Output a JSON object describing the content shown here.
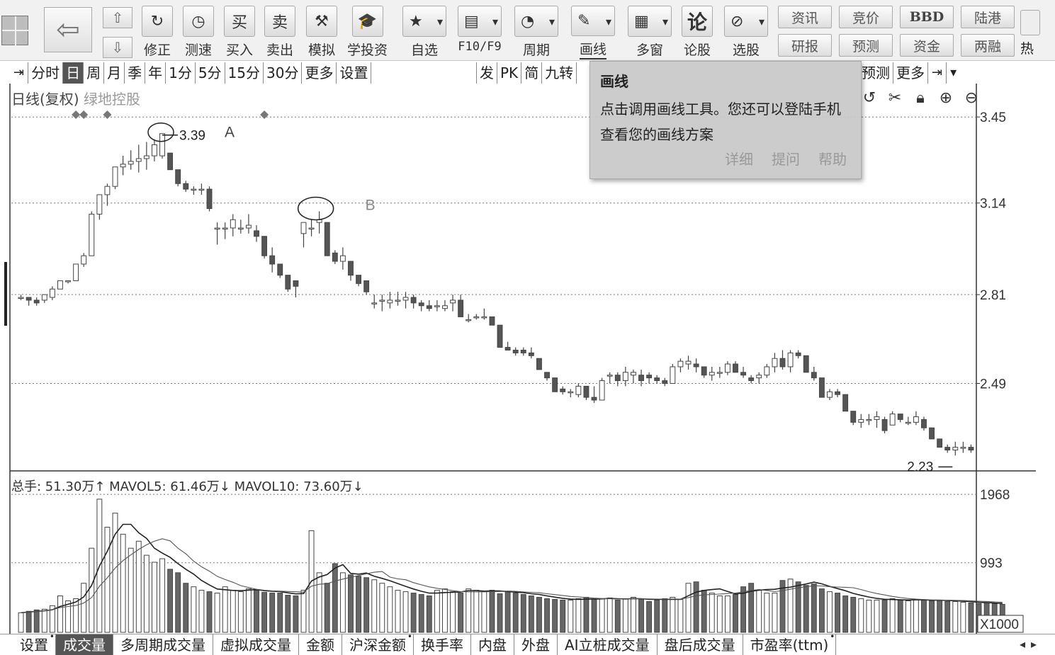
{
  "toolbar": {
    "logo_icon": "software-logo-icon",
    "back_icon": "back-arrow-icon",
    "up_icon": "up-arrow-icon",
    "down_icon": "down-arrow-icon",
    "buttons": [
      {
        "label": "修正",
        "icon": "refresh-icon"
      },
      {
        "label": "测速",
        "icon": "clock-icon"
      },
      {
        "label": "买入",
        "icon": "buy-icon",
        "glyph": "买"
      },
      {
        "label": "卖出",
        "icon": "sell-icon",
        "glyph": "卖"
      },
      {
        "label": "模拟",
        "icon": "gavel-icon"
      },
      {
        "label": "学投资",
        "icon": "graduation-cap-icon"
      },
      {
        "label": "自选",
        "icon": "favorites-folder-icon"
      },
      {
        "label": "F10/F9",
        "icon": "info-card-icon"
      },
      {
        "label": "周期",
        "icon": "period-clock-icon"
      },
      {
        "label": "画线",
        "icon": "pencil-icon"
      },
      {
        "label": "多窗",
        "icon": "multi-window-icon"
      },
      {
        "label": "论股",
        "icon": "discuss-icon",
        "glyph": "论"
      },
      {
        "label": "选股",
        "icon": "stock-picker-icon"
      }
    ],
    "small_buttons_top": [
      "资讯",
      "竞价",
      "BBD",
      "陆港"
    ],
    "small_buttons_bottom": [
      "研报",
      "预测",
      "资金",
      "两融"
    ],
    "hot_label": "热"
  },
  "period_tabs": [
    "分时",
    "日",
    "周",
    "月",
    "季",
    "年",
    "1分",
    "5分",
    "15分",
    "30分",
    "更多",
    "设置"
  ],
  "active_period": "日",
  "right_tabs": [
    "发",
    "PK",
    "简",
    "九转"
  ],
  "far_right_tabs": [
    "预测",
    "更多"
  ],
  "price_panel": {
    "title_prefix": "日线(复权)",
    "stock_name": "绿地控股",
    "axis_labels": [
      "3.45",
      "3.14",
      "2.81",
      "2.49"
    ],
    "high_label": "3.39",
    "low_label": "2.23",
    "annotation_a": "A",
    "annotation_b": "B"
  },
  "volume_panel": {
    "title": "总手: 51.30万↑ MAVOL5: 61.46万↓ MAVOL10: 73.60万↓",
    "axis_labels": [
      "1968",
      "993"
    ],
    "unit_label": "X1000"
  },
  "tooltip": {
    "title": "画线",
    "body": "点击调用画线工具。您还可以登陆手机查看您的画线方案",
    "links": [
      "详细",
      "提问",
      "帮助"
    ]
  },
  "bottom_tabs": [
    {
      "label": "设置",
      "dot": true
    },
    {
      "label": "成交量",
      "active": true
    },
    {
      "label": "多周期成交量"
    },
    {
      "label": "虚拟成交量"
    },
    {
      "label": "金额"
    },
    {
      "label": "沪深金额",
      "dot": true
    },
    {
      "label": "换手率"
    },
    {
      "label": "内盘"
    },
    {
      "label": "外盘"
    },
    {
      "label": "AI立桩成交量"
    },
    {
      "label": "盘后成交量"
    },
    {
      "label": "市盈率(ttm)",
      "dot": true
    }
  ],
  "chart_data": {
    "type": "candlestick",
    "price_ticks": [
      3.45,
      3.14,
      2.81,
      2.49
    ],
    "ylim": [
      2.18,
      3.55
    ],
    "high": 3.39,
    "low": 2.23,
    "ohlc": [
      [
        2.8,
        2.81,
        2.79,
        2.8
      ],
      [
        2.8,
        2.8,
        2.77,
        2.79
      ],
      [
        2.79,
        2.8,
        2.77,
        2.78
      ],
      [
        2.79,
        2.81,
        2.78,
        2.81
      ],
      [
        2.8,
        2.84,
        2.79,
        2.83
      ],
      [
        2.83,
        2.86,
        2.83,
        2.86
      ],
      [
        2.86,
        2.86,
        2.85,
        2.86
      ],
      [
        2.86,
        2.92,
        2.86,
        2.92
      ],
      [
        2.92,
        2.96,
        2.91,
        2.95
      ],
      [
        2.95,
        3.11,
        2.95,
        3.1
      ],
      [
        3.1,
        3.17,
        3.08,
        3.17
      ],
      [
        3.17,
        3.21,
        3.13,
        3.2
      ],
      [
        3.2,
        3.27,
        3.19,
        3.27
      ],
      [
        3.27,
        3.31,
        3.24,
        3.28
      ],
      [
        3.28,
        3.33,
        3.26,
        3.29
      ],
      [
        3.29,
        3.35,
        3.25,
        3.3
      ],
      [
        3.3,
        3.36,
        3.26,
        3.31
      ],
      [
        3.31,
        3.37,
        3.29,
        3.35
      ],
      [
        3.31,
        3.39,
        3.3,
        3.39
      ],
      [
        3.32,
        3.32,
        3.26,
        3.26
      ],
      [
        3.26,
        3.26,
        3.2,
        3.21
      ],
      [
        3.21,
        3.22,
        3.18,
        3.19
      ],
      [
        3.19,
        3.2,
        3.17,
        3.19
      ],
      [
        3.19,
        3.21,
        3.17,
        3.19
      ],
      [
        3.19,
        3.2,
        3.11,
        3.12
      ],
      [
        3.05,
        3.07,
        2.99,
        3.05
      ],
      [
        3.05,
        3.07,
        3.01,
        3.05
      ],
      [
        3.05,
        3.1,
        3.02,
        3.08
      ],
      [
        3.05,
        3.08,
        3.03,
        3.05
      ],
      [
        3.05,
        3.1,
        3.03,
        3.06
      ],
      [
        3.04,
        3.06,
        3.0,
        3.02
      ],
      [
        3.02,
        3.02,
        2.94,
        2.95
      ],
      [
        2.95,
        2.98,
        2.89,
        2.92
      ],
      [
        2.92,
        2.92,
        2.87,
        2.88
      ],
      [
        2.88,
        2.88,
        2.82,
        2.83
      ],
      [
        2.86,
        2.86,
        2.8,
        2.84
      ],
      [
        3.03,
        3.07,
        2.98,
        3.07
      ],
      [
        3.05,
        3.08,
        3.02,
        3.05
      ],
      [
        3.07,
        3.11,
        3.03,
        3.08
      ],
      [
        3.07,
        3.07,
        2.95,
        2.95
      ],
      [
        2.96,
        2.97,
        2.92,
        2.93
      ],
      [
        2.93,
        2.98,
        2.9,
        2.95
      ],
      [
        2.93,
        2.93,
        2.86,
        2.88
      ],
      [
        2.88,
        2.88,
        2.84,
        2.85
      ],
      [
        2.86,
        2.86,
        2.81,
        2.82
      ],
      [
        2.78,
        2.81,
        2.76,
        2.78
      ],
      [
        2.79,
        2.81,
        2.75,
        2.79
      ],
      [
        2.78,
        2.82,
        2.76,
        2.79
      ],
      [
        2.79,
        2.82,
        2.77,
        2.79
      ],
      [
        2.79,
        2.82,
        2.76,
        2.8
      ],
      [
        2.8,
        2.81,
        2.76,
        2.78
      ],
      [
        2.78,
        2.79,
        2.75,
        2.77
      ],
      [
        2.77,
        2.79,
        2.75,
        2.76
      ],
      [
        2.77,
        2.79,
        2.75,
        2.77
      ],
      [
        2.76,
        2.79,
        2.75,
        2.77
      ],
      [
        2.78,
        2.81,
        2.75,
        2.79
      ],
      [
        2.79,
        2.81,
        2.73,
        2.73
      ],
      [
        2.72,
        2.74,
        2.71,
        2.72
      ],
      [
        2.73,
        2.74,
        2.72,
        2.73
      ],
      [
        2.73,
        2.76,
        2.72,
        2.73
      ],
      [
        2.73,
        2.73,
        2.7,
        2.7
      ],
      [
        2.7,
        2.7,
        2.62,
        2.62
      ],
      [
        2.62,
        2.64,
        2.61,
        2.61
      ],
      [
        2.61,
        2.62,
        2.59,
        2.6
      ],
      [
        2.61,
        2.62,
        2.59,
        2.6
      ],
      [
        2.6,
        2.62,
        2.58,
        2.59
      ],
      [
        2.58,
        2.58,
        2.54,
        2.54
      ],
      [
        2.53,
        2.53,
        2.5,
        2.51
      ],
      [
        2.51,
        2.51,
        2.46,
        2.46
      ],
      [
        2.47,
        2.48,
        2.45,
        2.46
      ],
      [
        2.46,
        2.47,
        2.44,
        2.46
      ],
      [
        2.45,
        2.49,
        2.44,
        2.48
      ],
      [
        2.48,
        2.48,
        2.43,
        2.44
      ],
      [
        2.44,
        2.48,
        2.42,
        2.43
      ],
      [
        2.43,
        2.51,
        2.43,
        2.5
      ],
      [
        2.52,
        2.53,
        2.49,
        2.52
      ],
      [
        2.52,
        2.53,
        2.48,
        2.5
      ],
      [
        2.5,
        2.55,
        2.48,
        2.53
      ],
      [
        2.52,
        2.54,
        2.49,
        2.53
      ],
      [
        2.52,
        2.54,
        2.48,
        2.5
      ],
      [
        2.52,
        2.53,
        2.49,
        2.51
      ],
      [
        2.51,
        2.52,
        2.49,
        2.5
      ],
      [
        2.5,
        2.51,
        2.48,
        2.49
      ],
      [
        2.49,
        2.56,
        2.49,
        2.55
      ],
      [
        2.55,
        2.58,
        2.53,
        2.57
      ],
      [
        2.56,
        2.59,
        2.54,
        2.57
      ],
      [
        2.56,
        2.58,
        2.53,
        2.55
      ],
      [
        2.55,
        2.55,
        2.51,
        2.52
      ],
      [
        2.52,
        2.55,
        2.5,
        2.53
      ],
      [
        2.53,
        2.55,
        2.51,
        2.53
      ],
      [
        2.53,
        2.57,
        2.52,
        2.56
      ],
      [
        2.56,
        2.57,
        2.53,
        2.53
      ],
      [
        2.53,
        2.55,
        2.51,
        2.52
      ],
      [
        2.51,
        2.52,
        2.49,
        2.5
      ],
      [
        2.51,
        2.53,
        2.49,
        2.52
      ],
      [
        2.52,
        2.56,
        2.51,
        2.55
      ],
      [
        2.55,
        2.6,
        2.53,
        2.58
      ],
      [
        2.58,
        2.61,
        2.54,
        2.55
      ],
      [
        2.55,
        2.61,
        2.53,
        2.6
      ],
      [
        2.6,
        2.61,
        2.58,
        2.59
      ],
      [
        2.59,
        2.59,
        2.53,
        2.53
      ],
      [
        2.53,
        2.55,
        2.5,
        2.51
      ],
      [
        2.51,
        2.51,
        2.44,
        2.44
      ],
      [
        2.44,
        2.47,
        2.43,
        2.46
      ],
      [
        2.46,
        2.47,
        2.44,
        2.45
      ],
      [
        2.45,
        2.45,
        2.39,
        2.39
      ],
      [
        2.39,
        2.39,
        2.34,
        2.35
      ],
      [
        2.35,
        2.38,
        2.33,
        2.36
      ],
      [
        2.36,
        2.38,
        2.34,
        2.36
      ],
      [
        2.36,
        2.39,
        2.33,
        2.37
      ],
      [
        2.36,
        2.37,
        2.31,
        2.32
      ],
      [
        2.34,
        2.39,
        2.34,
        2.38
      ],
      [
        2.38,
        2.38,
        2.35,
        2.36
      ],
      [
        2.35,
        2.37,
        2.34,
        2.35
      ],
      [
        2.35,
        2.39,
        2.34,
        2.37
      ],
      [
        2.36,
        2.37,
        2.32,
        2.33
      ],
      [
        2.33,
        2.33,
        2.29,
        2.29
      ],
      [
        2.29,
        2.29,
        2.26,
        2.26
      ],
      [
        2.26,
        2.27,
        2.24,
        2.25
      ],
      [
        2.25,
        2.28,
        2.23,
        2.26
      ],
      [
        2.26,
        2.28,
        2.24,
        2.26
      ],
      [
        2.26,
        2.27,
        2.24,
        2.25
      ]
    ],
    "volume_ticks": [
      1968,
      993
    ],
    "volume_ylim": [
      0,
      2000
    ],
    "volume": [
      280,
      300,
      320,
      330,
      380,
      520,
      450,
      480,
      700,
      1200,
      1900,
      1500,
      1700,
      1400,
      1200,
      1300,
      1100,
      1000,
      1050,
      900,
      850,
      700,
      650,
      600,
      580,
      560,
      650,
      600,
      580,
      620,
      600,
      570,
      560,
      560,
      530,
      520,
      600,
      1450,
      850,
      700,
      980,
      850,
      820,
      800,
      780,
      750,
      700,
      650,
      600,
      580,
      560,
      540,
      520,
      600,
      620,
      580,
      560,
      620,
      600,
      580,
      600,
      550,
      580,
      560,
      540,
      520,
      500,
      480,
      470,
      460,
      460,
      480,
      500,
      470,
      480,
      490,
      460,
      480,
      500,
      470,
      440,
      460,
      480,
      500,
      470,
      700,
      720,
      600,
      560,
      520,
      520,
      540,
      650,
      700,
      600,
      560,
      560,
      740,
      760,
      720,
      670,
      690,
      620,
      580,
      560,
      520,
      500,
      480,
      460,
      460,
      460,
      480,
      460,
      450,
      470,
      460,
      450,
      460,
      440,
      440,
      430,
      420,
      410,
      420,
      410,
      400
    ]
  }
}
